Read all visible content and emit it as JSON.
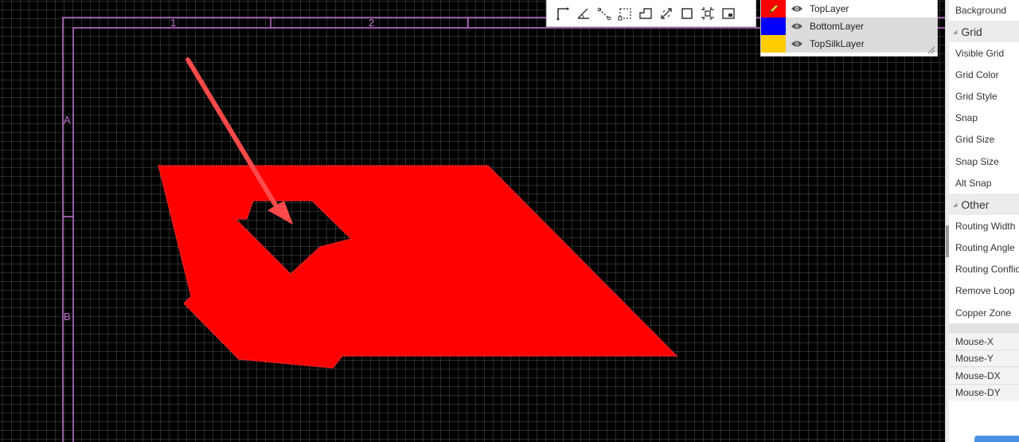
{
  "canvas": {
    "frame": {
      "column_labels": [
        "1",
        "2"
      ],
      "row_labels": [
        "A",
        "B"
      ]
    },
    "colors": {
      "background": "#000000",
      "grid": "#2e2e2e",
      "frame": "#c070d0",
      "copper": "#ff0000",
      "arrow": "#ff4040"
    }
  },
  "toolbar": {
    "tools": [
      "corner-line-icon",
      "angle-icon",
      "dotted-line-icon",
      "dashed-rectangle-icon",
      "outline-shape-icon",
      "resize-arrows-icon",
      "square-icon",
      "selection-frame-icon",
      "window-icon"
    ]
  },
  "layers": {
    "items": [
      {
        "name": "TopLayer",
        "color": "#ff0000",
        "icon": "pencil-icon",
        "visible_icon": "eye-icon",
        "selected": false
      },
      {
        "name": "BottomLayer",
        "color": "#0000ff",
        "visible_icon": "eye-icon",
        "selected": true
      },
      {
        "name": "TopSilkLayer",
        "color": "#ffcc00",
        "visible_icon": "eye-icon",
        "selected": true
      }
    ]
  },
  "panel": {
    "top_item": "Background",
    "sections": [
      {
        "title": "Grid",
        "items": [
          "Visible Grid",
          "Grid Color",
          "Grid Style",
          "Snap",
          "Grid Size",
          "Snap Size",
          "Alt Snap"
        ]
      },
      {
        "title": "Other",
        "items": [
          "Routing Width",
          "Routing Angle",
          "Routing Conflict",
          "Remove Loop",
          "Copper Zone"
        ]
      }
    ],
    "mouse": [
      "Mouse-X",
      "Mouse-Y",
      "Mouse-DX",
      "Mouse-DY"
    ]
  }
}
